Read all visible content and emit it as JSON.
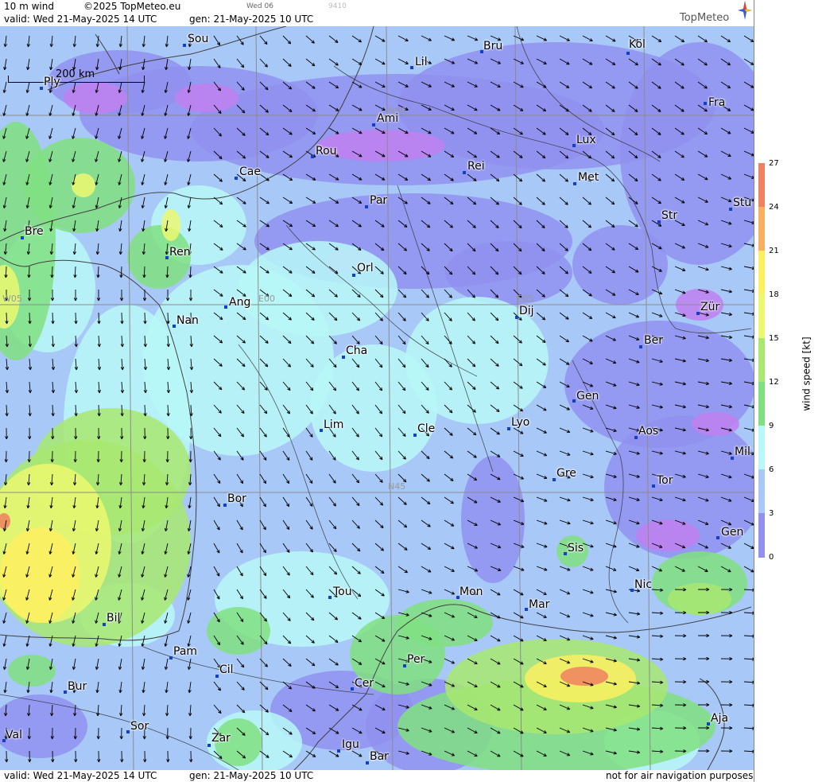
{
  "header": {
    "product": "10 m wind",
    "copyright": "©2025 TopMeteo.eu",
    "day_code": "Wed 06",
    "faint_code": "9410",
    "valid": "valid:  Wed  21-May-2025  14 UTC",
    "gen": "gen: 21-May-2025 10 UTC",
    "logo": "TopMeteo"
  },
  "footer": {
    "valid": "valid:  Wed  21-May-2025  14 UTC",
    "gen": "gen: 21-May-2025 10 UTC",
    "disclaimer": "not for air navigation purposes"
  },
  "scale_bar": "200 km",
  "legend": {
    "unit": "wind speed [kt]",
    "ticks": [
      "27",
      "24",
      "21",
      "18",
      "15",
      "12",
      "9",
      "6",
      "3",
      "0"
    ],
    "colors": [
      "#f08060",
      "#f8b060",
      "#fdf060",
      "#ecf870",
      "#a8e870",
      "#80e080",
      "#b8f8f8",
      "#a8c8f8",
      "#9090f0",
      "#c080f0"
    ]
  },
  "grid_labels": [
    "N50",
    "W05",
    "E00",
    "E05",
    "N45"
  ],
  "cities": [
    {
      "name": "Sou"
    },
    {
      "name": "Bru"
    },
    {
      "name": "Köl"
    },
    {
      "name": "Ply"
    },
    {
      "name": "Lil"
    },
    {
      "name": "Fra"
    },
    {
      "name": "Ami"
    },
    {
      "name": "Lux"
    },
    {
      "name": "Rou"
    },
    {
      "name": "Cae"
    },
    {
      "name": "Rei"
    },
    {
      "name": "Met"
    },
    {
      "name": "Par"
    },
    {
      "name": "Stu"
    },
    {
      "name": "Str"
    },
    {
      "name": "Bre"
    },
    {
      "name": "Ren"
    },
    {
      "name": "Orl"
    },
    {
      "name": "Ang"
    },
    {
      "name": "Dij"
    },
    {
      "name": "Zür"
    },
    {
      "name": "Nan"
    },
    {
      "name": "Cha"
    },
    {
      "name": "Ber"
    },
    {
      "name": "Gen"
    },
    {
      "name": "Lim"
    },
    {
      "name": "Cle"
    },
    {
      "name": "Lyo"
    },
    {
      "name": "Aos"
    },
    {
      "name": "Mil"
    },
    {
      "name": "Gre"
    },
    {
      "name": "Tor"
    },
    {
      "name": "Bor"
    },
    {
      "name": "Sis"
    },
    {
      "name": "Gen"
    },
    {
      "name": "Tou"
    },
    {
      "name": "Nic"
    },
    {
      "name": "Mon"
    },
    {
      "name": "Mar"
    },
    {
      "name": "Bil"
    },
    {
      "name": "Pam"
    },
    {
      "name": "Per"
    },
    {
      "name": "Cil"
    },
    {
      "name": "Bur"
    },
    {
      "name": "Cer"
    },
    {
      "name": "Sor"
    },
    {
      "name": "Aja"
    },
    {
      "name": "Val"
    },
    {
      "name": "Zar"
    },
    {
      "name": "Igu"
    },
    {
      "name": "Bar"
    }
  ]
}
